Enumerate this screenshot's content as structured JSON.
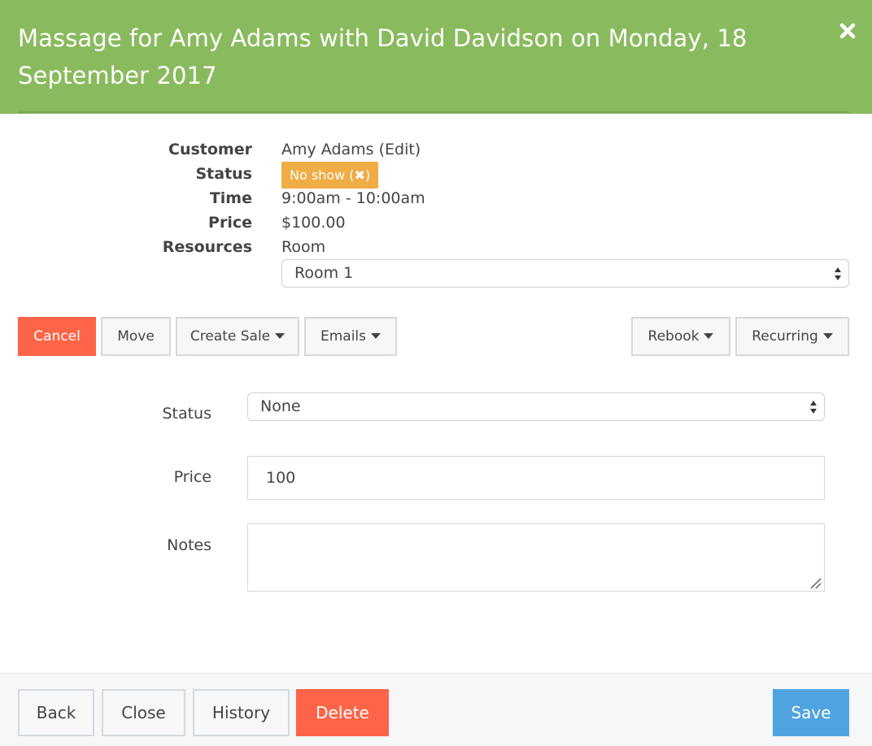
{
  "modal": {
    "title": "Massage for Amy Adams with David Davidson on Monday, 18 September 2017"
  },
  "details": {
    "customer_label": "Customer",
    "customer_value": "Amy Adams (Edit)",
    "status_label": "Status",
    "status_badge": "No show",
    "time_label": "Time",
    "time_value": "9:00am - 10:00am",
    "price_label": "Price",
    "price_value": "$100.00",
    "resources_label": "Resources",
    "resources_value": "Room",
    "resource_select_value": "Room 1"
  },
  "actions": {
    "cancel": "Cancel",
    "move": "Move",
    "create_sale": "Create Sale",
    "emails": "Emails",
    "rebook": "Rebook",
    "recurring": "Recurring"
  },
  "form": {
    "status_label": "Status",
    "status_value": "None",
    "price_label": "Price",
    "price_value": "100",
    "notes_label": "Notes",
    "notes_value": ""
  },
  "footer": {
    "back": "Back",
    "close": "Close",
    "history": "History",
    "delete": "Delete",
    "save": "Save"
  },
  "colors": {
    "header": "#8aba5e",
    "badge": "#f0ac45",
    "danger": "#fe6447",
    "primary": "#4fa3e0"
  },
  "icons": {
    "close": "close-icon",
    "badge_remove": "remove-circle-icon",
    "select_arrows": "select-arrows-icon",
    "caret": "caret-down-icon",
    "resize": "resize-grip-icon"
  }
}
